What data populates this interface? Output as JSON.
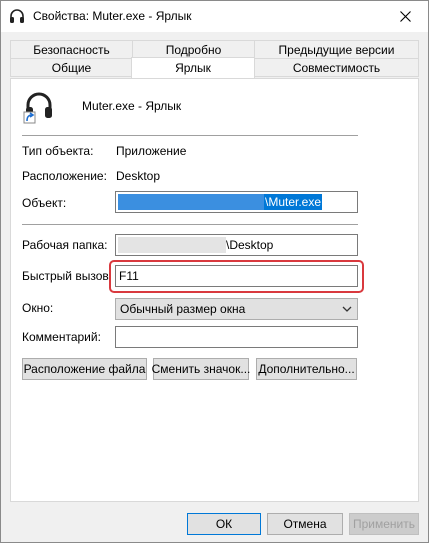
{
  "window": {
    "title": "Свойства: Muter.exe - Ярлык",
    "close_icon": "close-icon"
  },
  "tabs": {
    "row_back": [
      {
        "label": "Безопасность"
      },
      {
        "label": "Подробно"
      },
      {
        "label": "Предыдущие версии"
      }
    ],
    "row_front": [
      {
        "label": "Общие"
      },
      {
        "label": "Ярлык"
      },
      {
        "label": "Совместимость"
      }
    ],
    "active": "Ярлык"
  },
  "header": {
    "name": "Muter.exe - Ярлык",
    "icon": "headphones-shortcut-icon"
  },
  "info": {
    "type_label": "Тип объекта:",
    "type_value": "Приложение",
    "location_label": "Расположение:",
    "location_value": "Desktop"
  },
  "fields": {
    "target_label": "Объект:",
    "target_value": "\\Muter.exe",
    "start_in_label": "Рабочая папка:",
    "start_in_value": "\\Desktop",
    "hotkey_label": "Быстрый вызов:",
    "hotkey_value": "F11",
    "run_label": "Окно:",
    "run_value": "Обычный размер окна",
    "comment_label": "Комментарий:",
    "comment_value": ""
  },
  "actions": {
    "open_location": "Расположение файла",
    "change_icon": "Сменить значок...",
    "advanced": "Дополнительно..."
  },
  "footer": {
    "ok": "ОК",
    "cancel": "Отмена",
    "apply": "Применить"
  },
  "colors": {
    "selection": "#0078d7",
    "highlight": "#d9393e",
    "panel": "#ffffff",
    "chrome": "#f0f0f0"
  }
}
